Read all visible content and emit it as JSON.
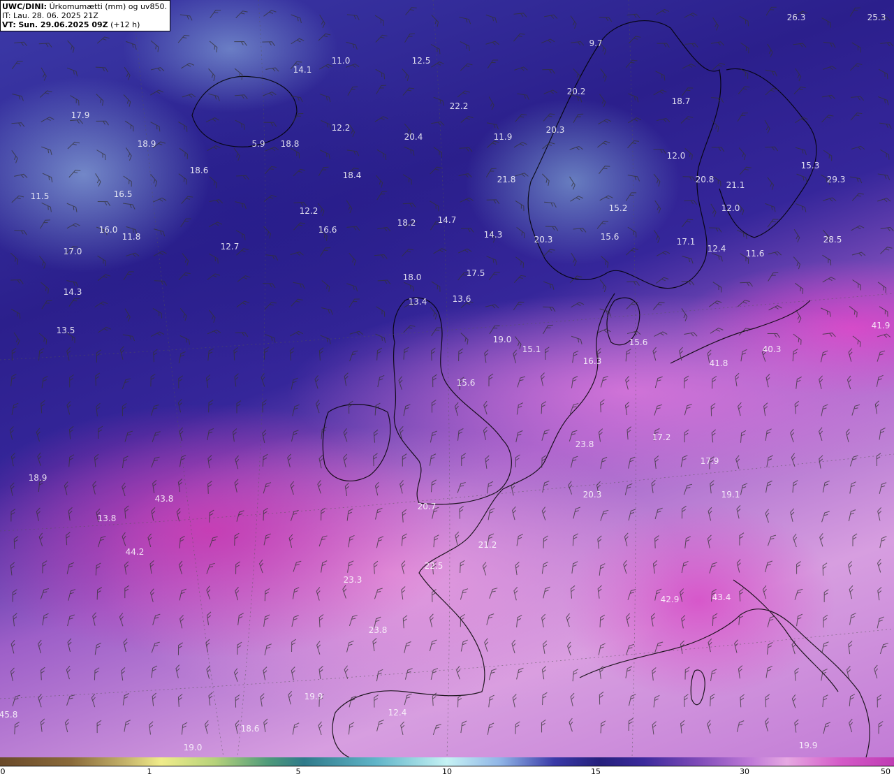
{
  "header": {
    "model": "UWC/DINI:",
    "parameter": "Úrkomumætti (mm) og uv850.",
    "initial_time": "IT: Lau. 28. 06. 2025 21Z",
    "valid_time_label": "VT:",
    "valid_time": "Sun. 29.06.2025 09Z",
    "lead_time": "(+12 h)"
  },
  "values": [
    "26.3",
    "25.3",
    "9.7",
    "14.1",
    "11.0",
    "12.5",
    "20.2",
    "18.7",
    "22.2",
    "17.9",
    "20.3",
    "11.9",
    "20.4",
    "12.2",
    "18.9",
    "5.9",
    "18.8",
    "12.0",
    "15.3",
    "18.6",
    "18.4",
    "21.8",
    "20.8",
    "21.1",
    "29.3",
    "11.5",
    "16.5",
    "12.2",
    "16.6",
    "18.2",
    "14.7",
    "15.2",
    "12.0",
    "16.0",
    "11.8",
    "14.3",
    "20.3",
    "15.6",
    "17.1",
    "12.4",
    "11.6",
    "28.5",
    "12.7",
    "17.0",
    "17.5",
    "14.3",
    "18.0",
    "13.4",
    "13.6",
    "19.0",
    "15.1",
    "13.5",
    "15.6",
    "16.3",
    "41.9",
    "40.3",
    "41.8",
    "15.6",
    "23.8",
    "17.2",
    "17.9",
    "18.9",
    "43.8",
    "20.3",
    "19.1",
    "13.8",
    "20.7",
    "21.2",
    "44.2",
    "22.5",
    "23.3",
    "23.8",
    "19.9",
    "12.4",
    "18.6",
    "19.0",
    "45.8",
    "42.9",
    "43.4",
    "19.9"
  ],
  "colorbar": {
    "unit": "mm",
    "ticks": [
      "0",
      "1",
      "5",
      "10",
      "15",
      "30",
      "50"
    ]
  },
  "colors": {
    "low_precip": "#2b1f8c",
    "mid_precip": "#c6f2f4",
    "high_precip": "#d45ac8",
    "coastline": "#000000",
    "barbs": "#333333"
  }
}
